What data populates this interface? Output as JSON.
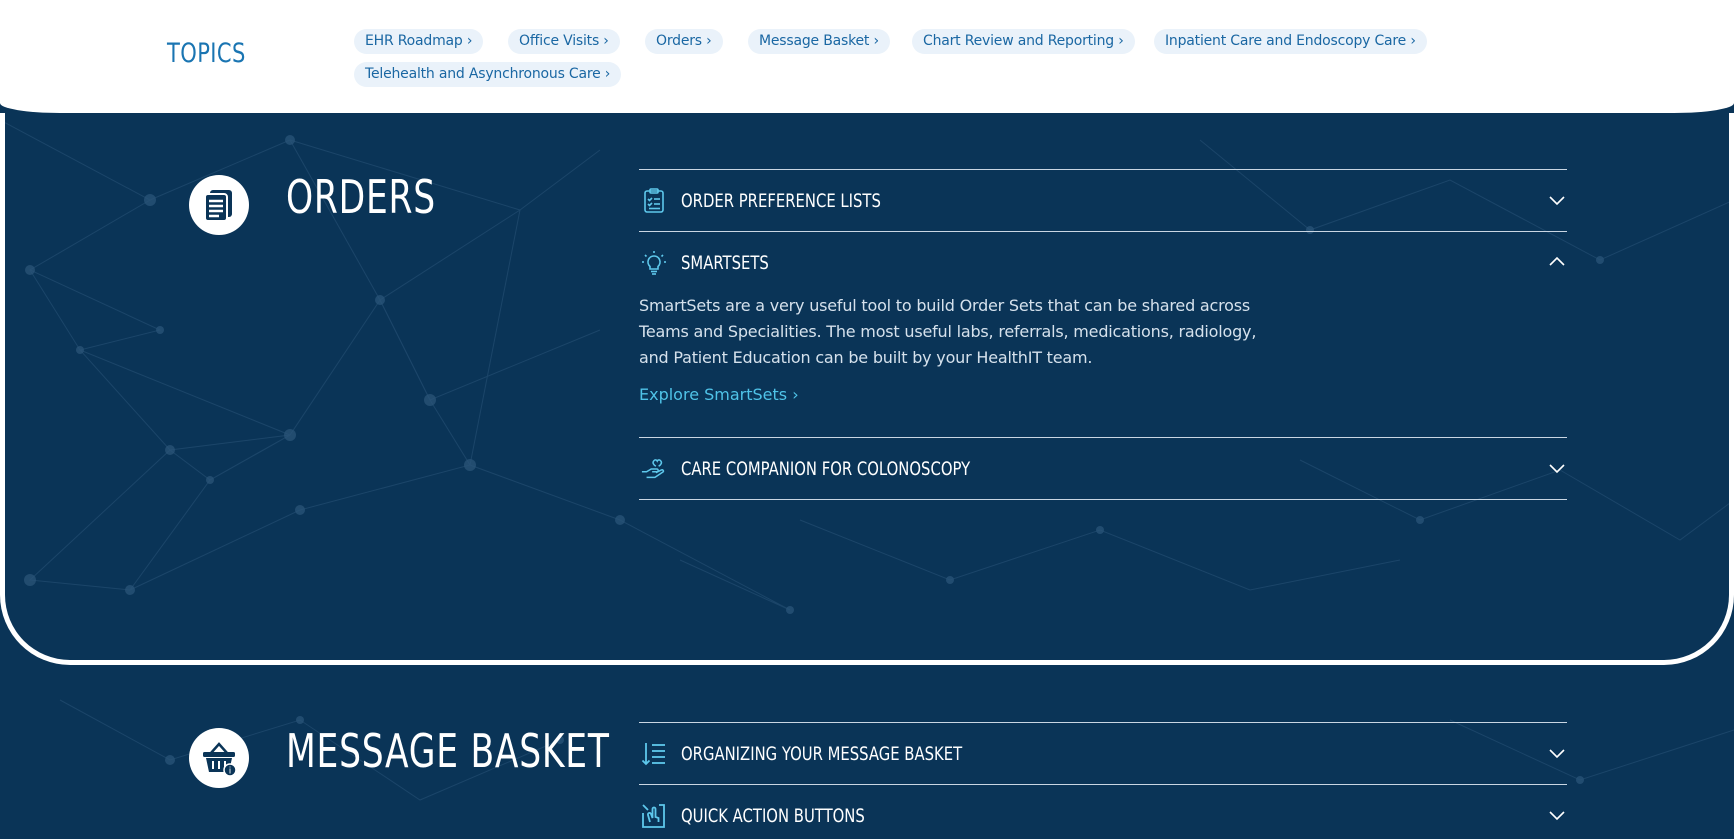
{
  "topics": {
    "title": "TOPICS",
    "links": [
      "EHR Roadmap ›",
      "Office Visits ›",
      "Orders ›",
      "Message Basket ›",
      "Chart Review and Reporting ›",
      "Inpatient Care and Endoscopy Care ›",
      "Telehealth and Asynchronous Care ›"
    ]
  },
  "orders": {
    "title": "ORDERS",
    "icon": "document-list-icon",
    "items": [
      {
        "label": "ORDER PREFERENCE LISTS",
        "icon": "clipboard-checklist-icon",
        "expanded": false
      },
      {
        "label": "SMARTSETS",
        "icon": "lightbulb-icon",
        "expanded": true,
        "body": "SmartSets are a very useful tool to build Order Sets that can be shared across Teams and Specialities. The most useful labs, referrals, medications, radiology, and Patient Education can be built by your HealthIT team.",
        "link": "Explore SmartSets ›"
      },
      {
        "label": "CARE COMPANION FOR COLONOSCOPY",
        "icon": "caring-hand-icon",
        "expanded": false
      }
    ]
  },
  "message_basket": {
    "title": "MESSAGE BASKET",
    "icon": "basket-icon",
    "items": [
      {
        "label": "ORGANIZING YOUR MESSAGE BASKET",
        "icon": "sort-list-icon",
        "expanded": false
      },
      {
        "label": "QUICK ACTION BUTTONS",
        "icon": "tap-button-icon",
        "expanded": false
      }
    ]
  },
  "colors": {
    "navy": "#0a3457",
    "accent": "#1a75b2",
    "link": "#4fc3e8",
    "pill_bg": "#eaf2fa"
  }
}
